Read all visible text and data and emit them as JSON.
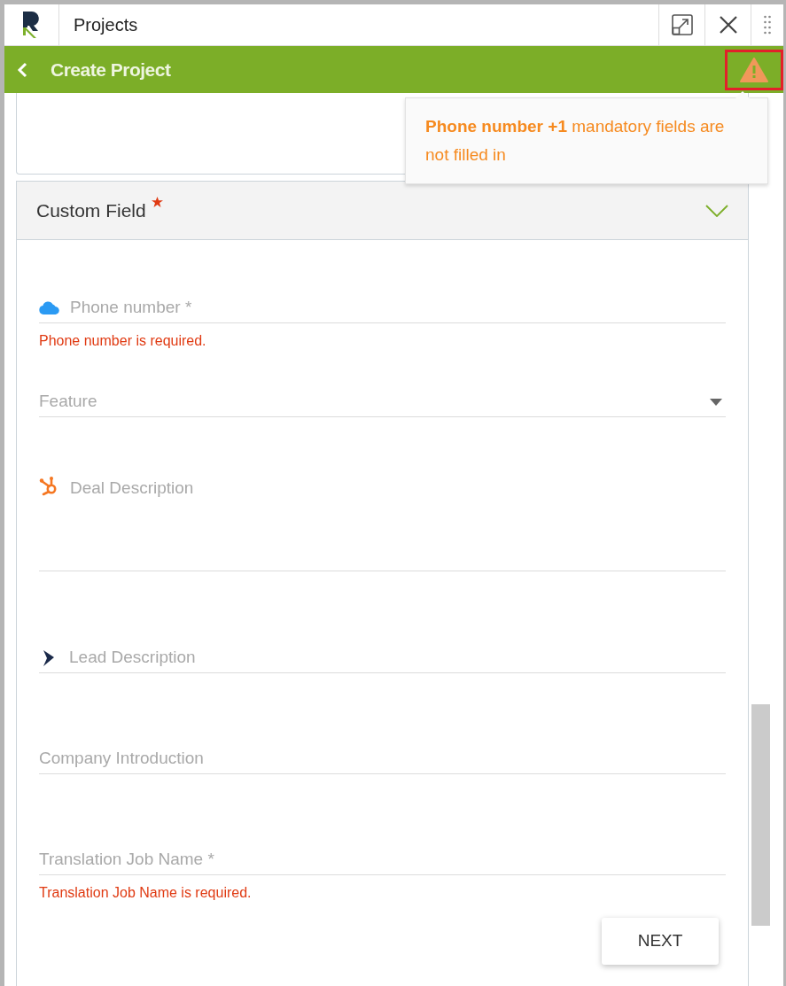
{
  "window": {
    "title": "Projects"
  },
  "header": {
    "title": "Create Project",
    "warning": true
  },
  "tooltip": {
    "text": "**Phone number +1** mandatory fields are not filled in"
  },
  "section": {
    "title": "Custom Field",
    "required": true,
    "expanded": true
  },
  "fields": [
    {
      "kind": "cloud",
      "placeholder": "Phone number *",
      "error": "Phone number is required."
    },
    {
      "kind": "select",
      "placeholder": "Feature"
    },
    {
      "kind": "hub",
      "placeholder": "Deal Description"
    },
    {
      "kind": "lead",
      "placeholder": "Lead Description"
    },
    {
      "kind": "text",
      "placeholder": "Company Introduction"
    },
    {
      "kind": "text",
      "placeholder": "Translation Job Name *",
      "error": "Translation Job Name is required."
    }
  ],
  "next_button": "NEXT"
}
